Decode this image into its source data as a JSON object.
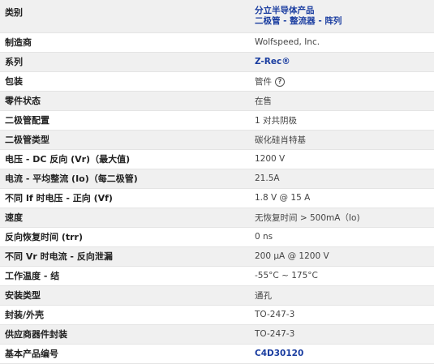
{
  "rows": [
    {
      "label": "类别",
      "lines": [
        "分立半导体产品",
        "二极管 - 整流器 - 阵列"
      ]
    },
    {
      "label": "制造商",
      "value": "Wolfspeed, Inc."
    },
    {
      "label": "系列",
      "value": "Z-Rec®"
    },
    {
      "label": "包装",
      "value": "管件",
      "help_icon": "?"
    },
    {
      "label": "零件状态",
      "value": "在售"
    },
    {
      "label": "二极管配置",
      "value": "1 对共阴极"
    },
    {
      "label": "二极管类型",
      "value": "碳化硅肖特基"
    },
    {
      "label": "电压 - DC 反向 (Vr)（最大值)",
      "value": "1200 V"
    },
    {
      "label": "电流 - 平均整流 (Io)（每二极管)",
      "value": "21.5A"
    },
    {
      "label": "不同 If 时电压 - 正向 (Vf)",
      "value": "1.8 V @ 15 A"
    },
    {
      "label": "速度",
      "value": "无恢复时间 > 500mA（Io)"
    },
    {
      "label": "反向恢复时间 (trr)",
      "value": "0 ns"
    },
    {
      "label": "不同 Vr 时电流 - 反向泄漏",
      "value": "200 µA @ 1200 V"
    },
    {
      "label": "工作温度 - 结",
      "value": "-55°C ~ 175°C"
    },
    {
      "label": "安装类型",
      "value": "通孔"
    },
    {
      "label": "封装/外壳",
      "value": "TO-247-3"
    },
    {
      "label": "供应商器件封装",
      "value": "TO-247-3"
    },
    {
      "label": "基本产品编号",
      "value": "C4D30120"
    }
  ]
}
